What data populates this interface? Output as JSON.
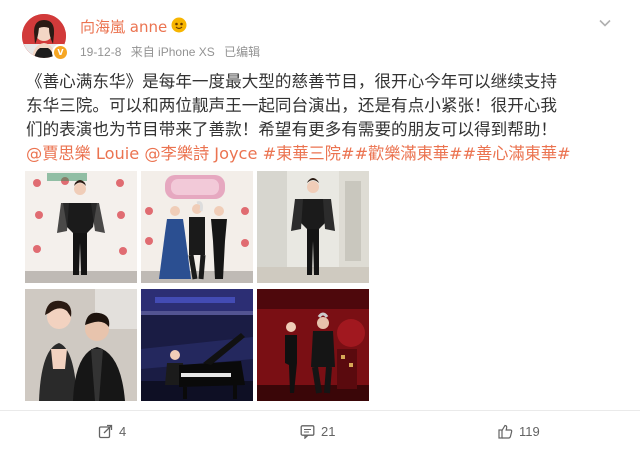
{
  "post": {
    "user": {
      "name": "向海嵐 anne",
      "avatar_icon": "avatar-portrait",
      "verified_icon": "verified-v-icon"
    },
    "meta": {
      "date": "19-12-8",
      "source": "来自 iPhone XS",
      "edited": "已编辑"
    },
    "text_lines": [
      "《善心满东华》是每年一度最大型的慈善节目，很开心今年可以继续支持",
      "东华三院。可以和两位靓声王一起同台演出，还是有点小紧张！很开心我",
      "们的表演也为节目带来了善款！希望有更多有需要的朋友可以得到帮助！"
    ],
    "mentions": [
      "@賈思樂 Louie",
      "@李樂詩 Joyce"
    ],
    "hashtags": [
      "#東華三院#",
      "#歡樂滿東華#",
      "#善心滿東華#"
    ],
    "photos": [
      {
        "name": "photo-red-carpet-solo"
      },
      {
        "name": "photo-red-carpet-group"
      },
      {
        "name": "photo-backstage-dress"
      },
      {
        "name": "photo-selfie-duo"
      },
      {
        "name": "photo-piano-stage"
      },
      {
        "name": "photo-stage-duet"
      }
    ]
  },
  "actions": {
    "share_count": "4",
    "comment_count": "21",
    "like_count": "119"
  },
  "colors": {
    "link": "#eb7350",
    "text": "#333333",
    "meta": "#939393"
  }
}
